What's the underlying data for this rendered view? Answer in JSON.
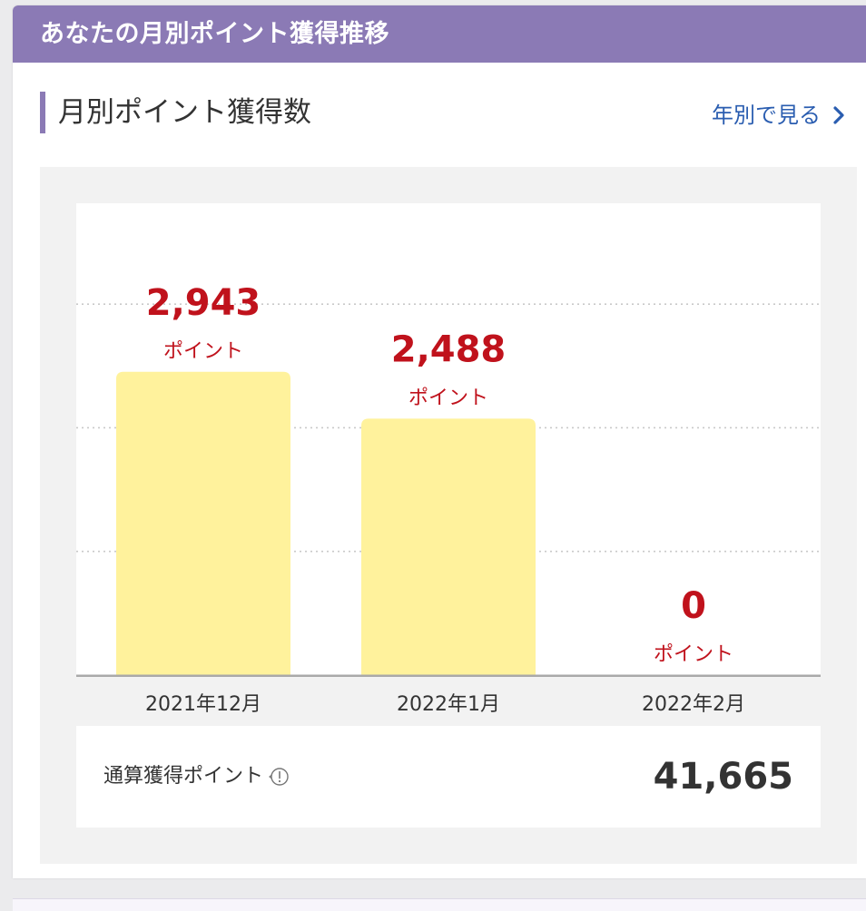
{
  "header": {
    "title": "あなたの月別ポイント獲得推移"
  },
  "section": {
    "title": "月別ポイント獲得数"
  },
  "year_link": {
    "label": "年別で見る",
    "icon": "chevron-right-icon"
  },
  "chart_data": {
    "type": "bar",
    "categories": [
      "2021年12月",
      "2022年1月",
      "2022年2月"
    ],
    "values": [
      2943,
      2488,
      0
    ],
    "value_labels": [
      "2,943",
      "2,488",
      "0"
    ],
    "unit_label": "ポイント",
    "ylim": [
      0,
      4200
    ],
    "gridlines": [
      1200,
      2400,
      3600
    ],
    "grid": true,
    "bar_color": "#fff29c",
    "value_color": "#c0121c",
    "title": "",
    "xlabel": "",
    "ylabel": ""
  },
  "total": {
    "label": "通算獲得ポイント",
    "value": "41,665",
    "icon": "info-icon"
  },
  "colors": {
    "accent": "#8b7ab5",
    "link": "#2a5db0",
    "value_red": "#c0121c"
  }
}
